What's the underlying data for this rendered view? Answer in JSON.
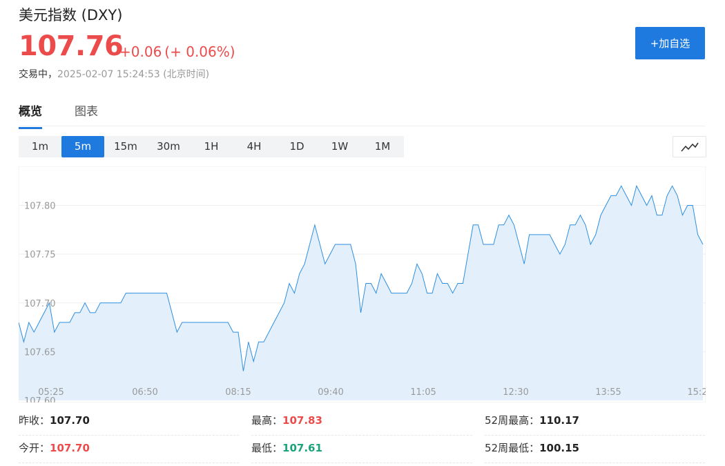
{
  "header": {
    "title": "美元指数 (DXY)",
    "price": "107.76",
    "change": "+0.06",
    "change_pct": "(+ 0.06%)",
    "status": "交易中，",
    "timestamp": "2025-02-07 15:24:53 (北京时间)",
    "add_button": "+加自选"
  },
  "tabs": [
    {
      "label": "概览",
      "active": true
    },
    {
      "label": "图表",
      "active": false
    }
  ],
  "periods": [
    "1m",
    "5m",
    "15m",
    "30m",
    "1H",
    "4H",
    "1D",
    "1W",
    "1M"
  ],
  "active_period": "5m",
  "colors": {
    "accent": "#1f7ae0",
    "up": "#ec4b4b",
    "down": "#1aa37a",
    "line": "#2d8ee0",
    "area": "#e3f0fc"
  },
  "stats": {
    "prev_close_label": "昨收：",
    "prev_close": "107.70",
    "open_label": "今开：",
    "open": "107.70",
    "high_label": "最高：",
    "high": "107.83",
    "low_label": "最低：",
    "low": "107.61",
    "w52_high_label": "52周最高：",
    "w52_high": "110.17",
    "w52_low_label": "52周最低：",
    "w52_low": "100.15"
  },
  "chart_data": {
    "type": "area",
    "xlabel": "",
    "ylabel": "",
    "ylim": [
      107.6,
      107.84
    ],
    "y_ticks": [
      "107.60",
      "107.65",
      "107.70",
      "107.75",
      "107.80"
    ],
    "x_ticks": [
      "05:25",
      "06:50",
      "08:15",
      "09:40",
      "11:05",
      "12:30",
      "13:55",
      "15:2"
    ],
    "x_start_time": "05:25",
    "x_interval_minutes": 5,
    "grid": true,
    "values": [
      107.68,
      107.66,
      107.68,
      107.67,
      107.68,
      107.69,
      107.7,
      107.67,
      107.68,
      107.68,
      107.68,
      107.69,
      107.69,
      107.7,
      107.69,
      107.69,
      107.7,
      107.7,
      107.7,
      107.7,
      107.7,
      107.71,
      107.71,
      107.71,
      107.71,
      107.71,
      107.71,
      107.71,
      107.71,
      107.71,
      107.69,
      107.67,
      107.68,
      107.68,
      107.68,
      107.68,
      107.68,
      107.68,
      107.68,
      107.68,
      107.68,
      107.68,
      107.67,
      107.67,
      107.63,
      107.66,
      107.64,
      107.66,
      107.66,
      107.67,
      107.68,
      107.69,
      107.7,
      107.72,
      107.71,
      107.73,
      107.74,
      107.76,
      107.78,
      107.76,
      107.74,
      107.75,
      107.76,
      107.76,
      107.76,
      107.76,
      107.74,
      107.69,
      107.72,
      107.72,
      107.71,
      107.73,
      107.72,
      107.71,
      107.71,
      107.71,
      107.71,
      107.72,
      107.74,
      107.73,
      107.71,
      107.71,
      107.73,
      107.72,
      107.72,
      107.71,
      107.72,
      107.72,
      107.75,
      107.78,
      107.78,
      107.76,
      107.76,
      107.76,
      107.78,
      107.78,
      107.79,
      107.78,
      107.76,
      107.74,
      107.77,
      107.77,
      107.77,
      107.77,
      107.77,
      107.76,
      107.75,
      107.76,
      107.78,
      107.78,
      107.79,
      107.78,
      107.76,
      107.77,
      107.79,
      107.8,
      107.81,
      107.81,
      107.82,
      107.81,
      107.8,
      107.82,
      107.81,
      107.8,
      107.81,
      107.79,
      107.79,
      107.81,
      107.82,
      107.81,
      107.79,
      107.8,
      107.8,
      107.77,
      107.76
    ]
  }
}
